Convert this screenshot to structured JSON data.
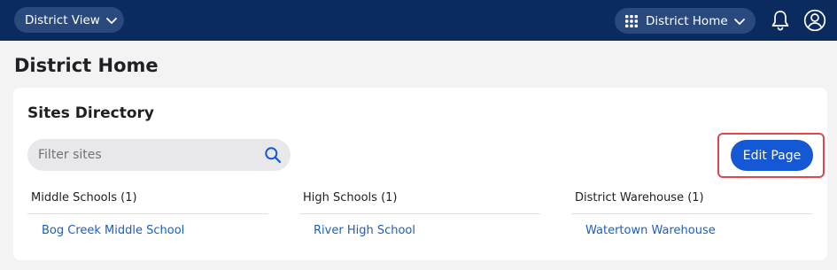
{
  "topbar": {
    "view_switcher_label": "District View",
    "app_switcher_label": "District Home",
    "icons": [
      "chevron-down-icon",
      "grid-icon",
      "bell-icon",
      "user-icon"
    ]
  },
  "page": {
    "title": "District Home"
  },
  "sites_directory": {
    "title": "Sites Directory",
    "filter_placeholder": "Filter sites",
    "filter_value": "",
    "edit_button_label": "Edit Page",
    "columns": [
      {
        "heading": "Middle Schools (1)",
        "links": [
          "Bog Creek Middle School"
        ]
      },
      {
        "heading": "High Schools (1)",
        "links": [
          "River High School"
        ]
      },
      {
        "heading": "District Warehouse (1)",
        "links": [
          "Watertown Warehouse"
        ]
      }
    ]
  },
  "colors": {
    "topbar_bg": "#0b2a5e",
    "pill_bg": "#2a4a7d",
    "primary_button": "#1558d6",
    "link": "#1a5fc4",
    "highlight_border": "#e0474c",
    "page_bg": "#f3f3f4"
  }
}
